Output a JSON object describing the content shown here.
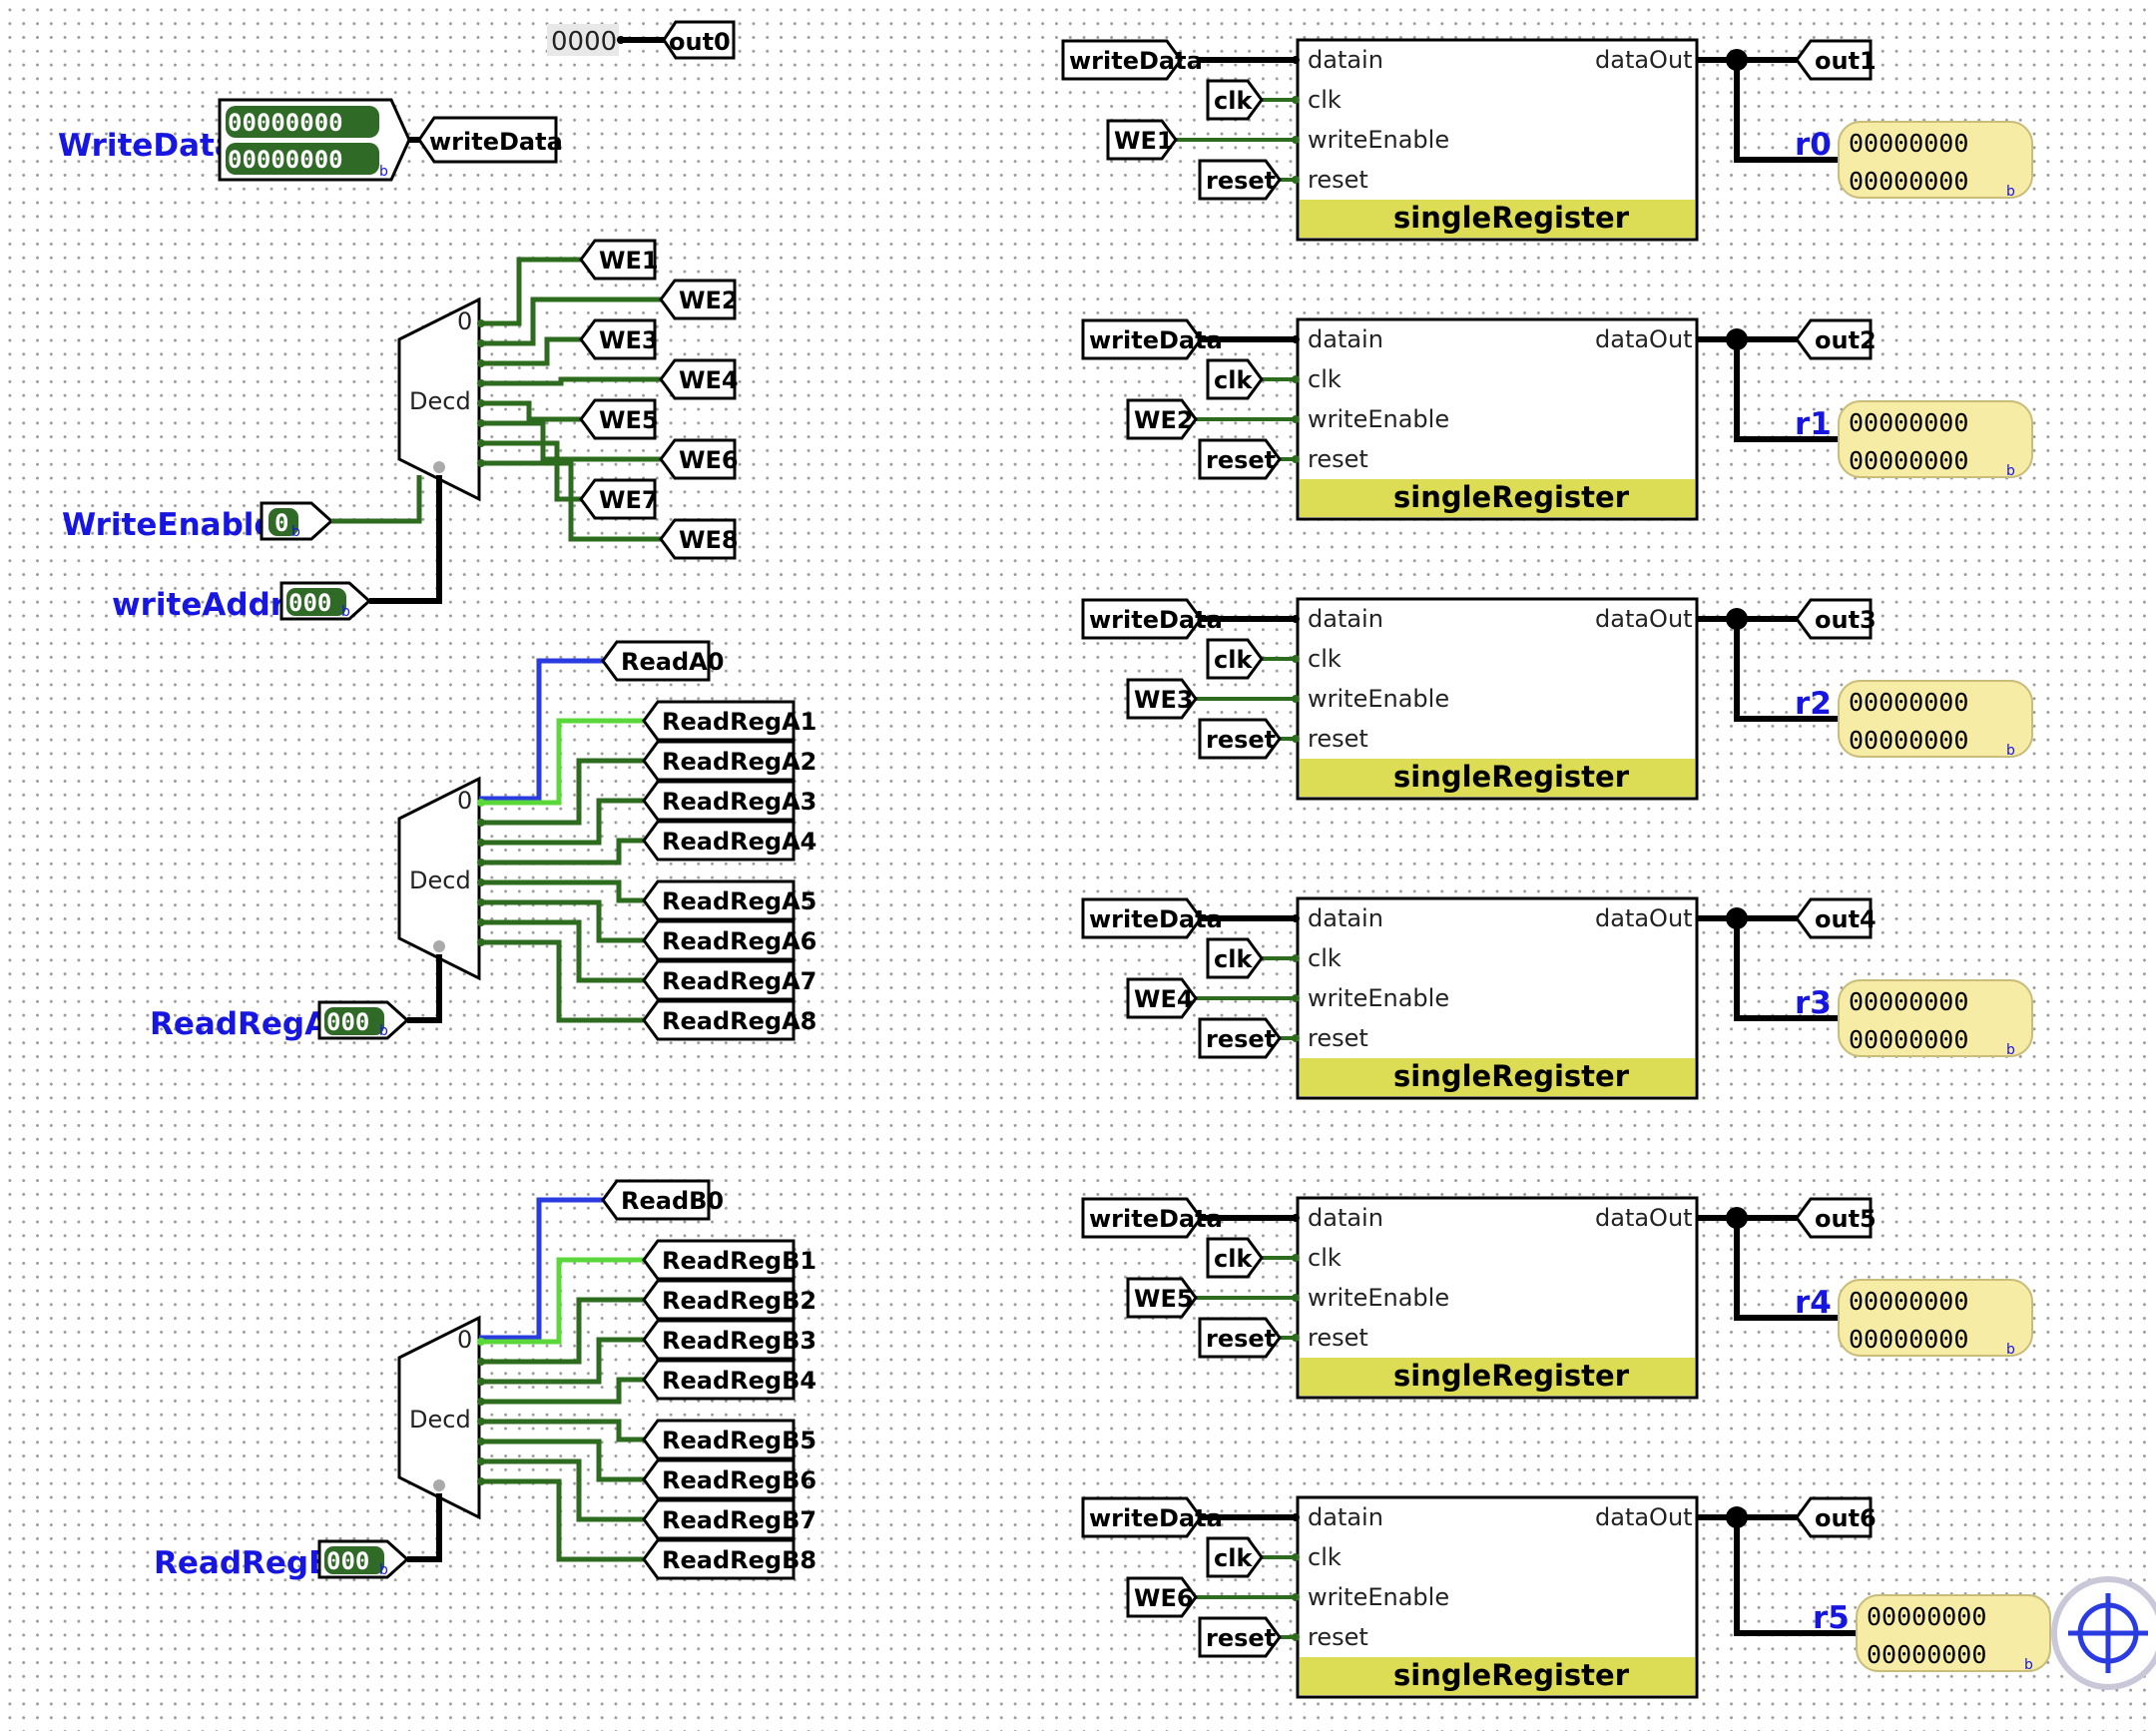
{
  "constant_value": "0000",
  "constant_output_tag": "out0",
  "inputs": {
    "write_data": {
      "label": "WriteData",
      "bits_top": "00000000",
      "bits_bottom": "00000000",
      "radix": "b",
      "tag": "writeData"
    },
    "write_enable": {
      "label": "WriteEnable",
      "bits": "0",
      "radix": "b"
    },
    "write_addr": {
      "label": "writeAddr",
      "bits": "000",
      "radix": "b"
    },
    "read_reg_a": {
      "label": "ReadRegA",
      "bits": "000",
      "radix": "b"
    },
    "read_reg_b": {
      "label": "ReadRegB",
      "bits": "000",
      "radix": "b"
    }
  },
  "decoder": {
    "label": "Decd",
    "zero_label": "0"
  },
  "write_enable_tags": [
    "WE1",
    "WE2",
    "WE3",
    "WE4",
    "WE5",
    "WE6",
    "WE7",
    "WE8"
  ],
  "read_a": {
    "zero_tag": "ReadA0",
    "tags": [
      "ReadRegA1",
      "ReadRegA2",
      "ReadRegA3",
      "ReadRegA4",
      "ReadRegA5",
      "ReadRegA6",
      "ReadRegA7",
      "ReadRegA8"
    ]
  },
  "read_b": {
    "zero_tag": "ReadB0",
    "tags": [
      "ReadRegB1",
      "ReadRegB2",
      "ReadRegB3",
      "ReadRegB4",
      "ReadRegB5",
      "ReadRegB6",
      "ReadRegB7",
      "ReadRegB8"
    ]
  },
  "register_component": {
    "name": "singleRegister",
    "pins": {
      "datain": "datain",
      "clk": "clk",
      "write_enable": "writeEnable",
      "reset": "reset",
      "data_out": "dataOut"
    },
    "input_tags": {
      "data": "writeData",
      "clk": "clk",
      "reset": "reset"
    }
  },
  "registers": [
    {
      "we": "WE1",
      "out": "out1",
      "probe": "r0",
      "value_top": "00000000",
      "value_bottom": "00000000",
      "radix": "b"
    },
    {
      "we": "WE2",
      "out": "out2",
      "probe": "r1",
      "value_top": "00000000",
      "value_bottom": "00000000",
      "radix": "b"
    },
    {
      "we": "WE3",
      "out": "out3",
      "probe": "r2",
      "value_top": "00000000",
      "value_bottom": "00000000",
      "radix": "b"
    },
    {
      "we": "WE4",
      "out": "out4",
      "probe": "r3",
      "value_top": "00000000",
      "value_bottom": "00000000",
      "radix": "b"
    },
    {
      "we": "WE5",
      "out": "out5",
      "probe": "r4",
      "value_top": "00000000",
      "value_bottom": "00000000",
      "radix": "b"
    },
    {
      "we": "WE6",
      "out": "out6",
      "probe": "r5",
      "value_top": "00000000",
      "value_bottom": "00000000",
      "radix": "b"
    }
  ],
  "colors": {
    "wire_bus": "#000000",
    "wire_low": "#2d6b1f",
    "wire_high": "#5ad83a",
    "wire_unknown": "#2a3be0",
    "label_blue": "#1616e0",
    "register_title_bg": "#dcdc55",
    "probe_bg": "#f7eca6",
    "pin_fill": "#2f6a26"
  },
  "icons": {
    "nav": "crosshair-icon"
  }
}
